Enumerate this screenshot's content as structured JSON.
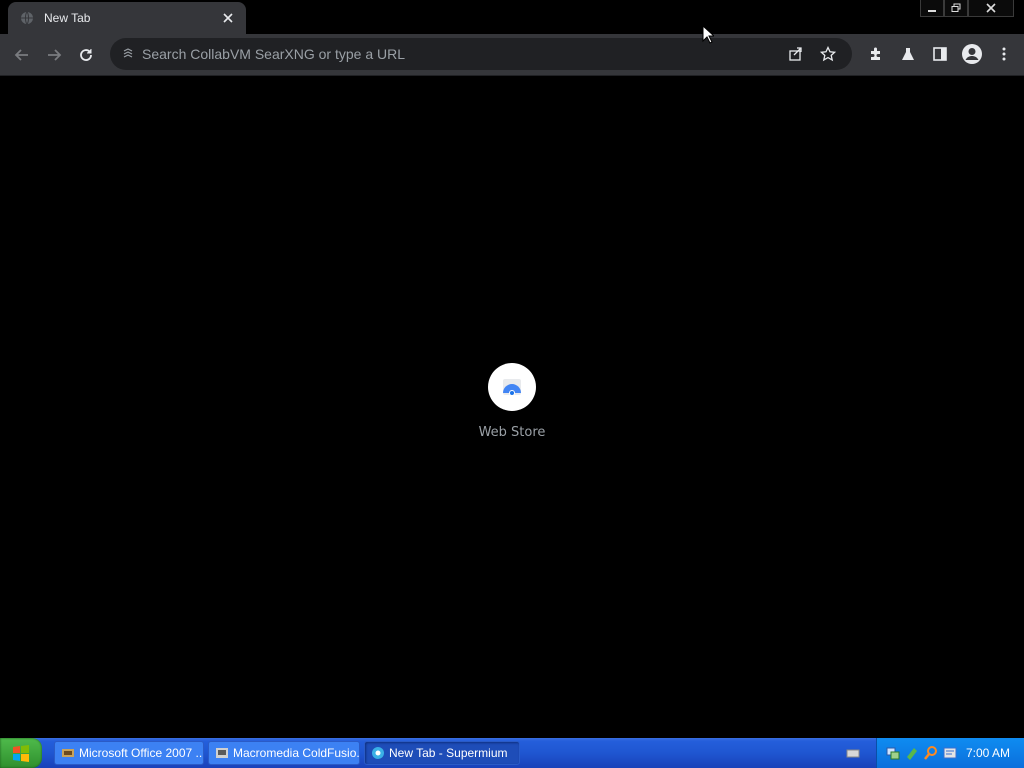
{
  "browser": {
    "tab": {
      "title": "New Tab"
    },
    "omnibox": {
      "placeholder": "Search CollabVM SearXNG or type a URL"
    }
  },
  "newtab": {
    "shortcuts": [
      {
        "label": "Web Store"
      }
    ]
  },
  "taskbar": {
    "tasks": [
      {
        "label": "Microsoft Office 2007 ..."
      },
      {
        "label": "Macromedia ColdFusio..."
      },
      {
        "label": "New Tab - Supermium"
      }
    ],
    "clock": "7:00 AM"
  },
  "colors": {
    "toolbar_bg": "#35363a",
    "omnibox_bg": "#202124",
    "taskbar_blue": "#245edb",
    "start_green": "#3fa53c"
  }
}
